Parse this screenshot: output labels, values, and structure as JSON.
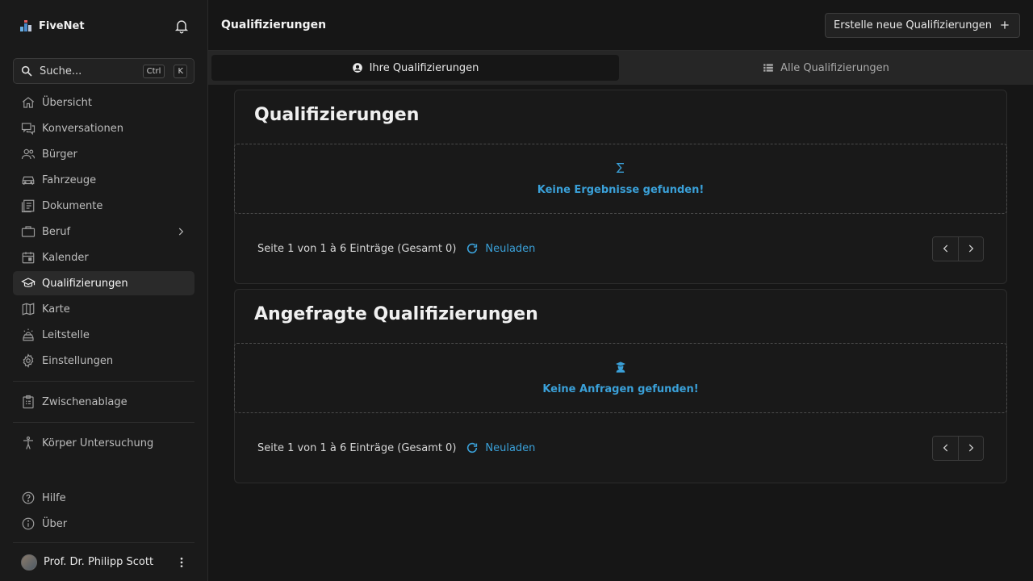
{
  "app": {
    "name": "FiveNet"
  },
  "search": {
    "placeholder": "Suche...",
    "kbd1": "Ctrl",
    "kbd2": "K"
  },
  "nav": [
    {
      "label": "Übersicht",
      "icon": "home-icon"
    },
    {
      "label": "Konversationen",
      "icon": "chat-icon"
    },
    {
      "label": "Bürger",
      "icon": "users-icon"
    },
    {
      "label": "Fahrzeuge",
      "icon": "car-icon"
    },
    {
      "label": "Dokumente",
      "icon": "documents-icon"
    },
    {
      "label": "Beruf",
      "icon": "briefcase-icon"
    },
    {
      "label": "Kalender",
      "icon": "calendar-icon"
    },
    {
      "label": "Qualifizierungen",
      "icon": "graduation-cap-icon"
    },
    {
      "label": "Karte",
      "icon": "map-icon"
    },
    {
      "label": "Leitstelle",
      "icon": "dispatch-icon"
    },
    {
      "label": "Einstellungen",
      "icon": "gear-icon"
    }
  ],
  "nav2": [
    {
      "label": "Zwischenablage",
      "icon": "clipboard-icon"
    },
    {
      "label": "Körper Untersuchung",
      "icon": "body-icon"
    }
  ],
  "bottom_nav": [
    {
      "label": "Hilfe",
      "icon": "help-icon"
    },
    {
      "label": "Über",
      "icon": "info-icon"
    }
  ],
  "user": {
    "name": "Prof. Dr. Philipp Scott"
  },
  "header": {
    "title": "Qualifizierungen",
    "create_label": "Erstelle neue Qualifizierungen"
  },
  "tabs": [
    {
      "label": "Ihre Qualifizierungen",
      "active": true
    },
    {
      "label": "Alle Qualifizierungen",
      "active": false
    }
  ],
  "sections": [
    {
      "title": "Qualifizierungen",
      "empty": "Keine Ergebnisse gefunden!",
      "pager": "Seite 1 von 1 à 6 Einträge (Gesamt 0)",
      "reload": "Neuladen"
    },
    {
      "title": "Angefragte Qualifizierungen",
      "empty": "Keine Anfragen gefunden!",
      "pager": "Seite 1 von 1 à 6 Einträge (Gesamt 0)",
      "reload": "Neuladen"
    }
  ],
  "colors": {
    "accent": "#3aa0d8",
    "background": "#161616",
    "sidebar": "#1a1a1a"
  }
}
